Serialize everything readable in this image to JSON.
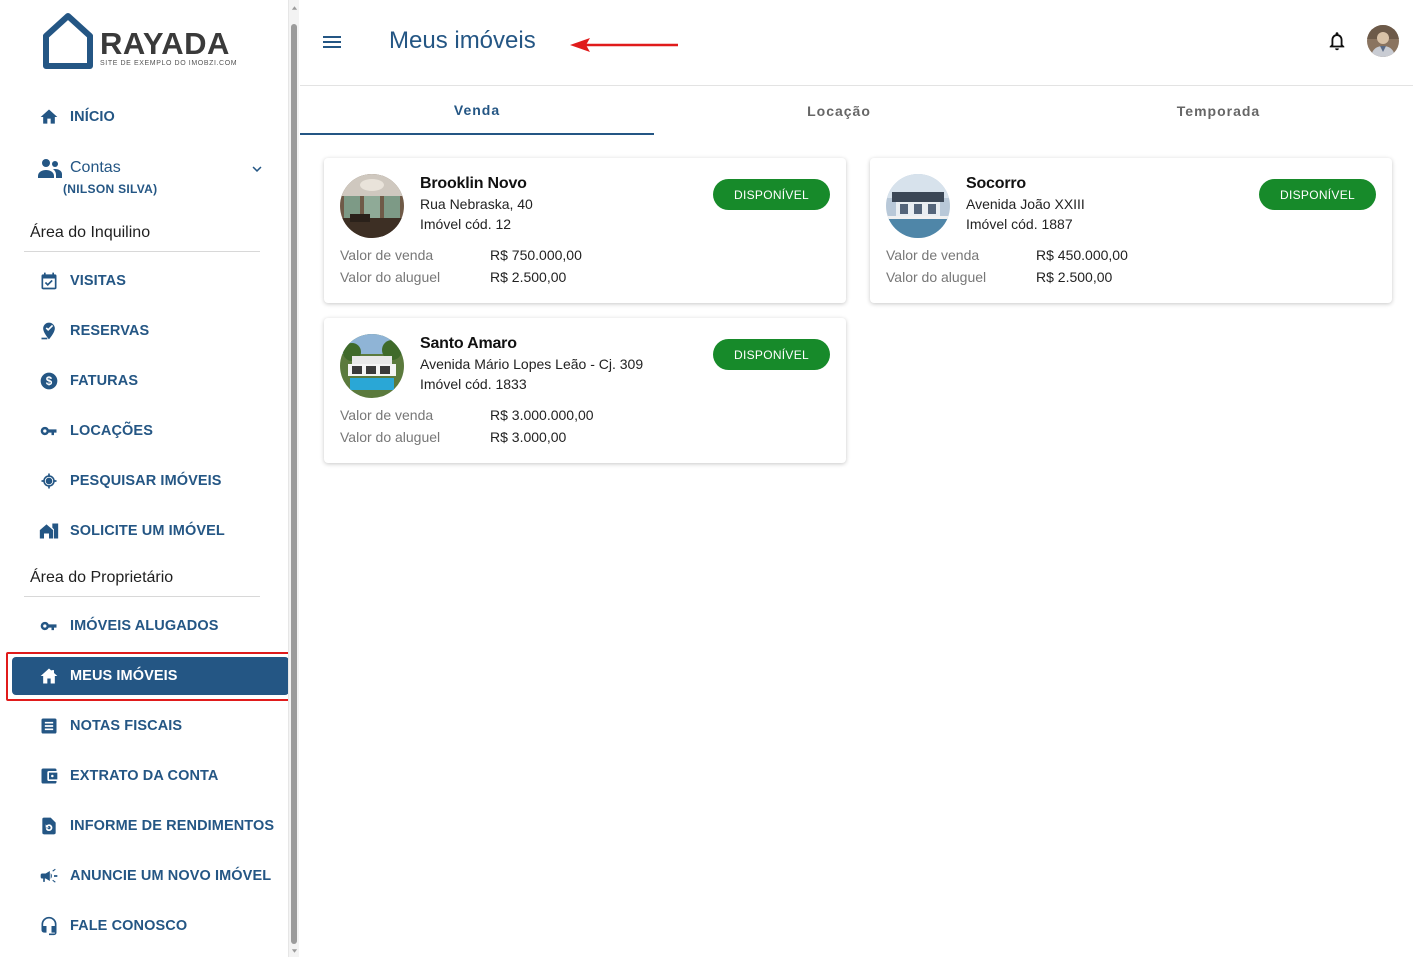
{
  "logo": {
    "name": "RAYADA",
    "tagline": "SITE DE EXEMPLO DO IMOBZI.COM"
  },
  "sidebar": {
    "inicio": "INÍCIO",
    "contas": {
      "label": "Contas",
      "user": "(NILSON SILVA)"
    },
    "section_inquilino": "Área do Inquilino",
    "inquilino_items": [
      {
        "label": "VISITAS",
        "icon": "calendar-check-icon"
      },
      {
        "label": "RESERVAS",
        "icon": "pin-check-icon"
      },
      {
        "label": "FATURAS",
        "icon": "dollar-circle-icon"
      },
      {
        "label": "LOCAÇÕES",
        "icon": "key-icon"
      },
      {
        "label": "PESQUISAR IMÓVEIS",
        "icon": "crosshair-icon"
      },
      {
        "label": "SOLICITE UM IMÓVEL",
        "icon": "house-request-icon"
      }
    ],
    "section_proprietario": "Área do Proprietário",
    "proprietario_items": [
      {
        "label": "IMÓVEIS ALUGADOS",
        "icon": "key-icon"
      },
      {
        "label": "MEUS IMÓVEIS",
        "icon": "home-icon"
      },
      {
        "label": "NOTAS FISCAIS",
        "icon": "document-icon"
      },
      {
        "label": "EXTRATO DA CONTA",
        "icon": "wallet-icon"
      },
      {
        "label": "INFORME DE RENDIMENTOS",
        "icon": "refresh-doc-icon"
      },
      {
        "label": "ANUNCIE UM NOVO IMÓVEL",
        "icon": "megaphone-icon"
      },
      {
        "label": "FALE CONOSCO",
        "icon": "headset-icon"
      }
    ]
  },
  "header": {
    "title": "Meus imóveis"
  },
  "tabs": [
    "Venda",
    "Locação",
    "Temporada"
  ],
  "properties": [
    {
      "name": "Brooklin Novo",
      "address": "Rua Nebraska, 40",
      "code": "Imóvel cód. 12",
      "status": "DISPONÍVEL",
      "sale_label": "Valor de venda",
      "sale_value": "R$ 750.000,00",
      "rent_label": "Valor do aluguel",
      "rent_value": "R$ 2.500,00"
    },
    {
      "name": "Socorro",
      "address": "Avenida João XXIII",
      "code": "Imóvel cód. 1887",
      "status": "DISPONÍVEL",
      "sale_label": "Valor de venda",
      "sale_value": "R$ 450.000,00",
      "rent_label": "Valor do aluguel",
      "rent_value": "R$ 2.500,00"
    },
    {
      "name": "Santo Amaro",
      "address": "Avenida Mário Lopes Leão - Cj. 309",
      "code": "Imóvel cód. 1833",
      "status": "DISPONÍVEL",
      "sale_label": "Valor de venda",
      "sale_value": "R$ 3.000.000,00",
      "rent_label": "Valor do aluguel",
      "rent_value": "R$ 3.000,00"
    }
  ],
  "colors": {
    "primary": "#245684",
    "success": "#178a2a",
    "annotation": "#e01b1b"
  }
}
